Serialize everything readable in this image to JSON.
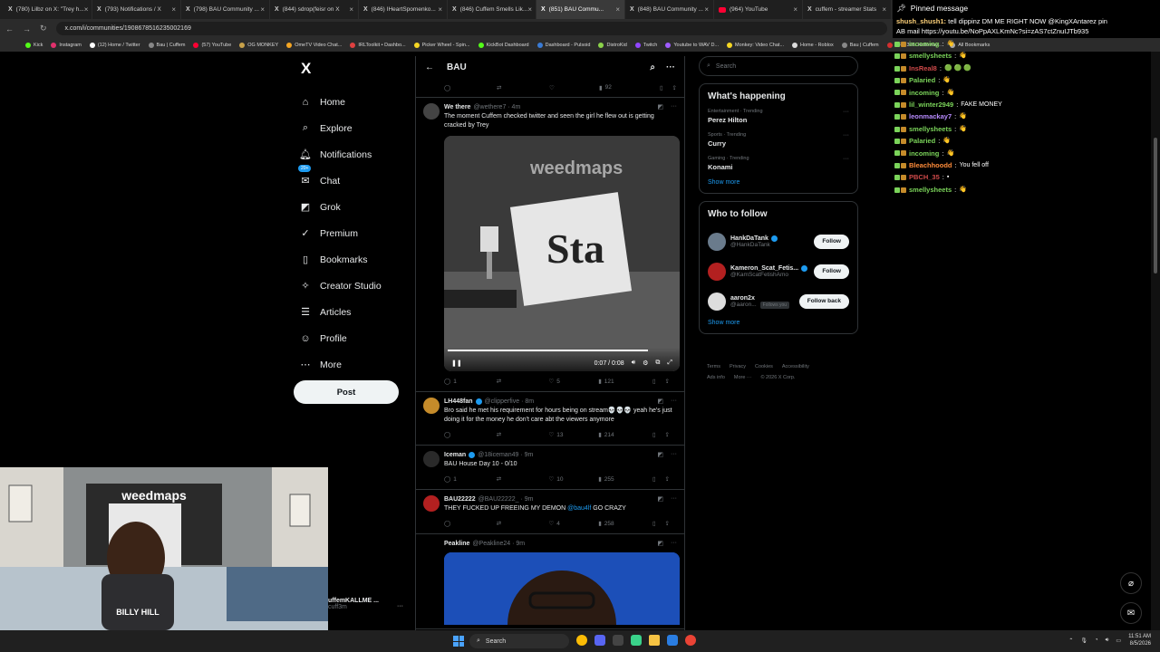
{
  "browser": {
    "tabs": [
      {
        "icon": "x",
        "label": "(780) Lilbz on X: \"Trey h..."
      },
      {
        "icon": "x",
        "label": "(793) Notifications / X"
      },
      {
        "icon": "x",
        "label": "(798) BAU Community ..."
      },
      {
        "icon": "x",
        "label": "(844) sdrop(feisr on X"
      },
      {
        "icon": "x",
        "label": "(846) IHeartSpomenko..."
      },
      {
        "icon": "x",
        "label": "(846) Cuffem Smells Lik..."
      },
      {
        "icon": "x",
        "label": "(851) BAU Commu...",
        "active": true
      },
      {
        "icon": "x",
        "label": "(848) BAU Community ..."
      },
      {
        "icon": "yt",
        "label": "(964) YouTube"
      },
      {
        "icon": "x",
        "label": "cuffem - streamer Stats"
      }
    ],
    "url": "x.com/i/communities/1908678516235002169",
    "bookmarks": [
      {
        "label": "Kick",
        "color": "#53fc18"
      },
      {
        "label": "Instagram",
        "color": "#e1306c"
      },
      {
        "label": "(12) Home / Twitter",
        "color": "#ffffff"
      },
      {
        "label": "Bau | Cuffem",
        "color": "#888888"
      },
      {
        "label": "(57) YouTube",
        "color": "#ff0033"
      },
      {
        "label": "OG MONKEY",
        "color": "#c8a24a"
      },
      {
        "label": "OmeTV Video Chat...",
        "color": "#f5a623"
      },
      {
        "label": "IRLToolkit • Dashbo...",
        "color": "#e04040"
      },
      {
        "label": "Picker Wheel - Spin...",
        "color": "#f5d623"
      },
      {
        "label": "KickBot Dashboard",
        "color": "#53fc18"
      },
      {
        "label": "Dashboard - Pulsoid",
        "color": "#3a7bd5"
      },
      {
        "label": "DistroKid",
        "color": "#8bd34a"
      },
      {
        "label": "Twitch",
        "color": "#9146ff"
      },
      {
        "label": "Youtube to WAV D...",
        "color": "#a05cff"
      },
      {
        "label": "Monkey: Video Chat...",
        "color": "#f5d623"
      },
      {
        "label": "Home - Roblox",
        "color": "#dddddd"
      },
      {
        "label": "Bau | Cuffem",
        "color": "#888888"
      },
      {
        "label": "UFC 326: Holloway...",
        "color": "#d32f2f"
      },
      {
        "label": "All Bookmarks",
        "color": "#aaaaaa"
      }
    ]
  },
  "nav": {
    "logo": "X",
    "items": [
      {
        "icon": "home-icon",
        "glyph": "⌂",
        "label": "Home"
      },
      {
        "icon": "search-icon",
        "glyph": "⌕",
        "label": "Explore"
      },
      {
        "icon": "bell-icon",
        "glyph": "🔔︎",
        "label": "Notifications"
      },
      {
        "icon": "chat-icon",
        "glyph": "✉",
        "label": "Chat",
        "badge": "20+"
      },
      {
        "icon": "grok-icon",
        "glyph": "◩",
        "label": "Grok"
      },
      {
        "icon": "premium-icon",
        "glyph": "✓",
        "label": "Premium"
      },
      {
        "icon": "bookmark-icon",
        "glyph": "▯",
        "label": "Bookmarks"
      },
      {
        "icon": "creator-studio-icon",
        "glyph": "✧",
        "label": "Creator Studio"
      },
      {
        "icon": "articles-icon",
        "glyph": "☰",
        "label": "Articles"
      },
      {
        "icon": "profile-icon",
        "glyph": "☺",
        "label": "Profile"
      },
      {
        "icon": "more-icon",
        "glyph": "⋯",
        "label": "More"
      }
    ],
    "post_label": "Post",
    "account_name": "uffemKALLME ...",
    "account_handle": "cuff3m"
  },
  "feed": {
    "title": "BAU",
    "top_actions": {
      "views": "92"
    },
    "tweets": [
      {
        "name": "We there",
        "handle": "@wethere7 · 4m",
        "verified": false,
        "avatar_color": "#444444",
        "text": "The moment Cuffem checked twitter and seen the girl he flew out is getting cracked by Trey",
        "video": {
          "time": "0:07 / 0:08",
          "progress": 0.875,
          "watermark": "weedmaps"
        },
        "actions": {
          "replies": "1",
          "reposts": "",
          "likes": "5",
          "views": "121"
        }
      },
      {
        "name": "LH448fan",
        "handle": "@clipperfive · 8m",
        "verified": true,
        "avatar_color": "#c58b2a",
        "text": "Bro said he met his requirement for hours being on stream💀💀💀 yeah he's just doing it for the money he don't care abt the viewers anymore",
        "actions": {
          "replies": "",
          "reposts": "",
          "likes": "13",
          "views": "214"
        }
      },
      {
        "name": "Iceman",
        "handle": "@18iceman49 · 9m",
        "verified": true,
        "avatar_color": "#2a2a2a",
        "text": "BAU House Day 10 - 0/10",
        "actions": {
          "replies": "1",
          "reposts": "",
          "likes": "10",
          "views": "255"
        }
      },
      {
        "name": "BAU22222",
        "handle": "@BAU22222_ · 9m",
        "verified": false,
        "avatar_color": "#b32020",
        "text_before": "THEY FUCKED UP FREEING MY DEMON ",
        "mention": "@bau4lf",
        "text_after": " GO CRAZY",
        "actions": {
          "replies": "",
          "reposts": "",
          "likes": "4",
          "views": "258"
        }
      },
      {
        "name": "Peakline",
        "handle": "@Peakline24 · 9m",
        "verified": false,
        "avatar_color": "#000000"
      }
    ]
  },
  "sidebar": {
    "search_placeholder": "Search",
    "happening_title": "What's happening",
    "trends": [
      {
        "context": "Entertainment · Trending",
        "title": "Perez Hilton"
      },
      {
        "context": "Sports · Trending",
        "title": "Curry"
      },
      {
        "context": "Gaming · Trending",
        "title": "Konami"
      }
    ],
    "show_more": "Show more",
    "wtf_title": "Who to follow",
    "follow": [
      {
        "name": "HankDaTank",
        "handle": "@HankDaTank",
        "verified": true,
        "button": "Follow",
        "avatar_color": "#6a7b8c"
      },
      {
        "name": "Kameron_Scat_Fetis...",
        "handle": "@KamScatFetishAmo",
        "verified": true,
        "button": "Follow",
        "avatar_color": "#b32020"
      },
      {
        "name": "aaron2x",
        "handle": "@aaron...",
        "verified": false,
        "follows_you": "Follows you",
        "button": "Follow back",
        "avatar_color": "#dddddd"
      }
    ],
    "footer": [
      "Terms",
      "Privacy",
      "Cookies",
      "Accessibility",
      "Ads info",
      "More ···",
      "© 2026 X Corp."
    ]
  },
  "chat": {
    "pinned_title": "Pinned message",
    "pinned_user": "shush_shush1:",
    "pinned_text": "tell dippinz DM ME RIGHT NOW @KingXAntarez pin",
    "pinned_line2": "AB mail https://youtu.be/NoPpAXLKmNc?si=zAS7ctZnuIJTb935",
    "messages": [
      {
        "user": "incoming",
        "color": "#7bd45a",
        "text": "👋"
      },
      {
        "user": "smellysheets",
        "color": "#7bd45a",
        "text": "👋"
      },
      {
        "user": "InsReal8",
        "color": "#d04a4a",
        "text": "🟢 🟢 🟢"
      },
      {
        "user": "Palaried",
        "color": "#7bd45a",
        "text": "👋"
      },
      {
        "user": "incoming",
        "color": "#7bd45a",
        "text": "👋"
      },
      {
        "user": "lil_winter2949",
        "color": "#7bd45a",
        "text": "FAKE MONEY"
      },
      {
        "user": "leonmackay7",
        "color": "#b88bff",
        "text": "👋"
      },
      {
        "user": "smellysheets",
        "color": "#7bd45a",
        "text": "👋"
      },
      {
        "user": "Palaried",
        "color": "#7bd45a",
        "text": "👋"
      },
      {
        "user": "incoming",
        "color": "#7bd45a",
        "text": "👋"
      },
      {
        "user": "Bleachhoodd",
        "color": "#ff8c3a",
        "text": "You fell off"
      },
      {
        "user": "PBCH_35",
        "color": "#d04a4a",
        "text": "▪"
      },
      {
        "user": "smellysheets",
        "color": "#7bd45a",
        "text": "👋"
      }
    ]
  },
  "taskbar": {
    "search": "Search",
    "time": "11:51 AM",
    "date": "8/5/2026"
  },
  "webcam": {
    "shirt_text": "BILLY HILL",
    "banner": "weedmaps"
  }
}
